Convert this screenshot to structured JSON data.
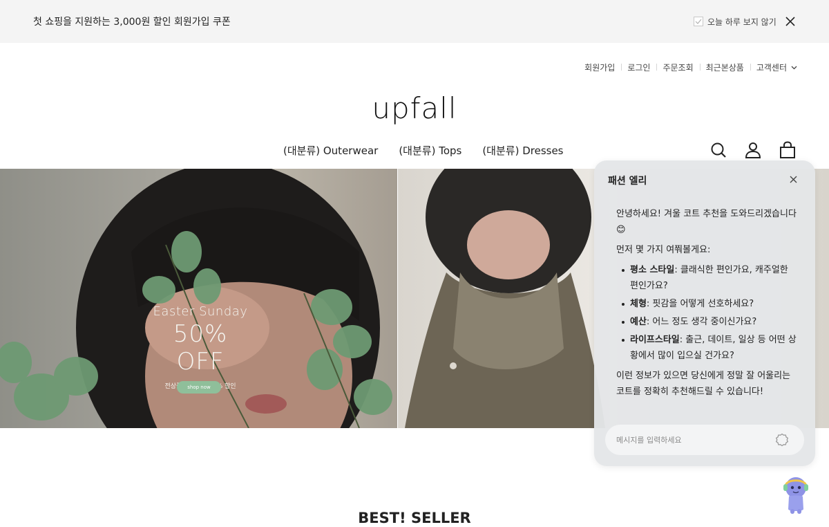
{
  "promo": {
    "text": "첫 쇼핑을 지원하는 3,000원 할인 회원가입 쿠폰",
    "hide_today": "오늘 하루 보지 않기"
  },
  "utility_nav": [
    "회원가입",
    "로그인",
    "주문조회",
    "최근본상품",
    "고객센터"
  ],
  "logo": "upfall",
  "main_nav": [
    "(대분류) Outerwear",
    "(대분류) Tops",
    "(대분류) Dresses"
  ],
  "hero": {
    "line1": "Easter Sunday",
    "line2": "50% OFF",
    "line3": "전상품 회원한정 50% 할인",
    "button": "shop now"
  },
  "section_title": "BEST! SELLER",
  "chat": {
    "title": "패션 엘리",
    "intro": "안녕하세요! 겨울 코트 추천을 도와드리겠습니다 😊",
    "ask": "먼저 몇 가지 여쭤볼게요:",
    "questions": [
      {
        "key": "평소 스타일",
        "text": ": 클래식한 편인가요, 캐주얼한 편인가요?"
      },
      {
        "key": "체형",
        "text": ": 핏감을 어떻게 선호하세요?"
      },
      {
        "key": "예산",
        "text": ": 어느 정도 생각 중이신가요?"
      },
      {
        "key": "라이프스타일",
        "text": ": 출근, 데이트, 일상 등 어떤 상황에서 많이 입으실 건가요?"
      }
    ],
    "closing": "이런 정보가 있으면 당신에게 정말 잘 어울리는 코트를 정확히 추천해드릴 수 있습니다!",
    "input_placeholder": "메시지를 입력하세요",
    "input_value": ""
  },
  "colors": {
    "promo_bg": "#f4f4f4",
    "chat_bg": "#e4e6e8",
    "shop_button": "#8fbf9a"
  }
}
